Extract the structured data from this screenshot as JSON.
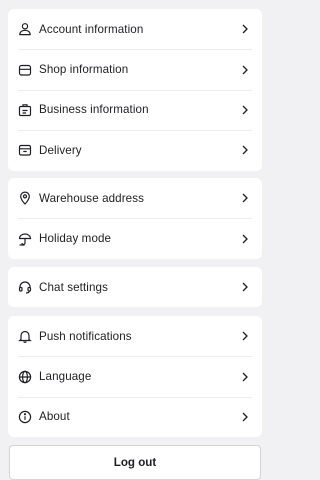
{
  "groups": [
    {
      "items": [
        {
          "label": "Account information",
          "icon": "user-icon"
        },
        {
          "label": "Shop information",
          "icon": "store-icon"
        },
        {
          "label": "Business information",
          "icon": "briefcase-icon"
        },
        {
          "label": "Delivery",
          "icon": "delivery-box-icon"
        }
      ]
    },
    {
      "items": [
        {
          "label": "Warehouse address",
          "icon": "location-pin-icon"
        },
        {
          "label": "Holiday mode",
          "icon": "beach-umbrella-icon"
        }
      ]
    },
    {
      "items": [
        {
          "label": "Chat settings",
          "icon": "headset-icon"
        }
      ]
    },
    {
      "items": [
        {
          "label": "Push notifications",
          "icon": "bell-icon"
        },
        {
          "label": "Language",
          "icon": "globe-icon"
        },
        {
          "label": "About",
          "icon": "info-icon"
        }
      ]
    }
  ],
  "logout_label": "Log out",
  "colors": {
    "background": "#f1f1f3",
    "card": "#ffffff",
    "text": "#1f1f23",
    "divider": "#ececee",
    "button_border": "#d4d4d8"
  }
}
